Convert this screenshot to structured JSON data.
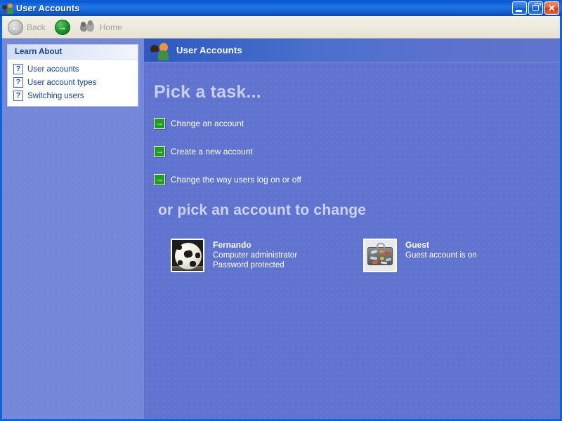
{
  "window": {
    "title": "User Accounts",
    "icon": "user-accounts-icon",
    "buttons": {
      "minimize": "Minimize",
      "restore": "Restore",
      "close": "Close"
    }
  },
  "toolbar": {
    "back_label": "Back",
    "back_icon": "back-arrow-icon",
    "forward_icon": "forward-arrow-icon",
    "home_label": "Home",
    "home_icon": "users-home-icon"
  },
  "sidebar": {
    "panel": {
      "title": "Learn About",
      "links": [
        {
          "label": "User accounts",
          "icon": "help-question-icon"
        },
        {
          "label": "User account types",
          "icon": "help-question-icon"
        },
        {
          "label": "Switching users",
          "icon": "help-question-icon"
        }
      ]
    }
  },
  "content": {
    "banner": {
      "title": "User Accounts",
      "icon": "user-accounts-icon"
    },
    "pick_task_heading": "Pick a task...",
    "tasks": [
      {
        "label": "Change an account",
        "icon": "green-arrow-icon"
      },
      {
        "label": "Create a new account",
        "icon": "green-arrow-icon"
      },
      {
        "label": "Change the way users log on or off",
        "icon": "green-arrow-icon"
      }
    ],
    "pick_account_heading": "or pick an account to change",
    "accounts": [
      {
        "name": "Fernando",
        "type": "Computer administrator",
        "status": "Password protected",
        "avatar": "soccer-ball-avatar"
      },
      {
        "name": "Guest",
        "type": "Guest account is on",
        "status": "",
        "avatar": "suitcase-avatar"
      }
    ]
  },
  "colors": {
    "titlebar_blue": "#0e5fd8",
    "content_bg": "#6074cf",
    "sidebar_bg": "#7487d9",
    "task_green": "#1f9c23",
    "heading_text": "#c8cfee",
    "link_blue": "#13419c"
  }
}
